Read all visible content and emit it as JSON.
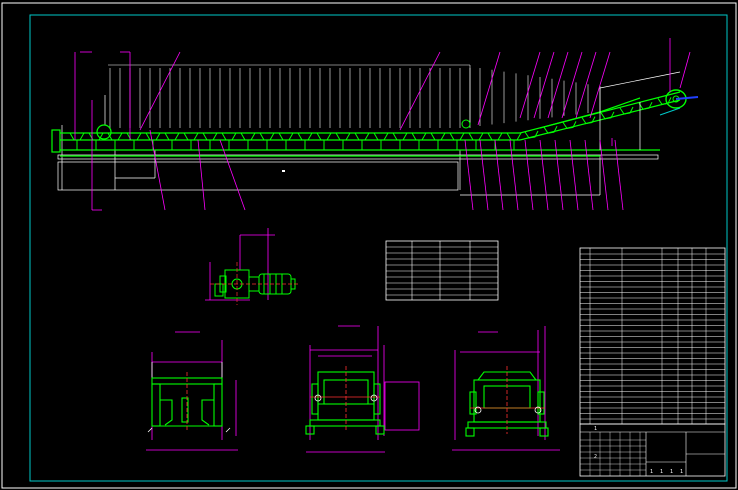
{
  "colors": {
    "background": "#000000",
    "frame": "#ffffff",
    "inner_frame": "#00c8c8",
    "belt": "#00ff00",
    "dimension": "#ff00ff",
    "outline": "#ffffff",
    "centerline": "#ff3030",
    "accent": "#2040ff"
  },
  "drawing": {
    "main_view": "belt-conveyor-elevation",
    "drive_view": "motor-reducer-plan",
    "sections": [
      "tail-section",
      "middle-section",
      "head-section"
    ],
    "tables": [
      "parts-list",
      "title-block"
    ]
  },
  "title_block": {
    "row_label_a": "1",
    "row_label_b": "2",
    "cells": [
      "1",
      "1",
      "1",
      "1"
    ]
  }
}
